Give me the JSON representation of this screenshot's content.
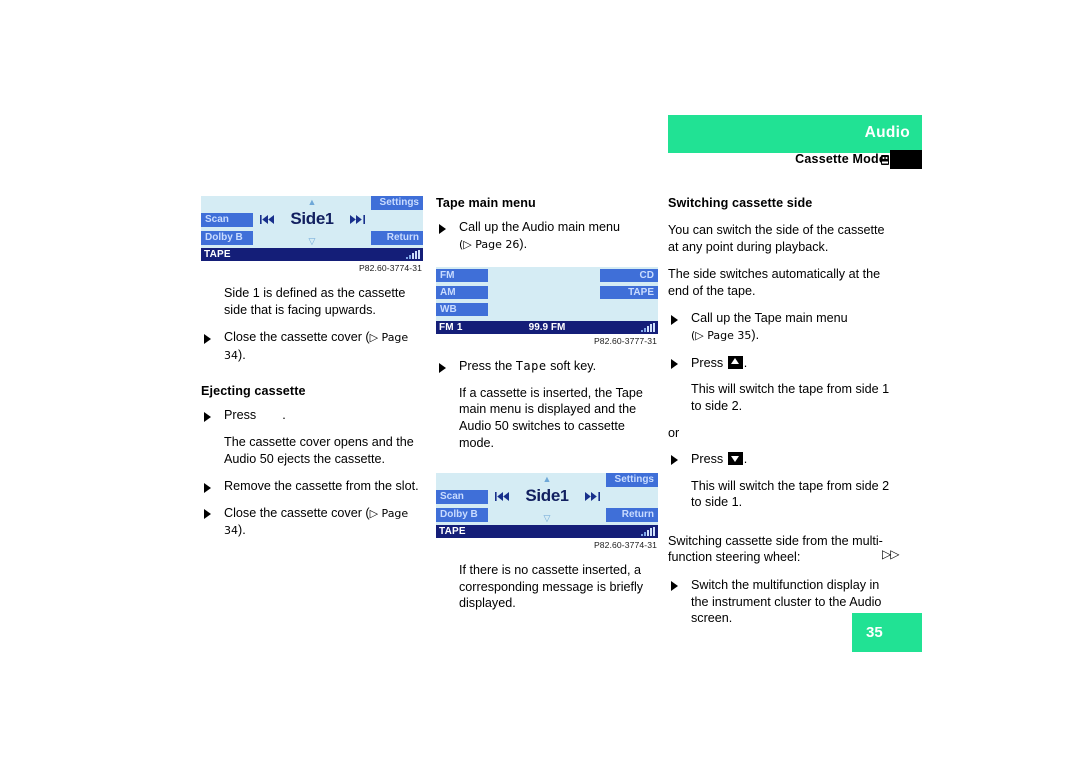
{
  "header": {
    "brand": "Audio",
    "section": "Cassette Mode",
    "brand_color": "#21e294"
  },
  "page_number": "35",
  "continuation_marker": "▷▷",
  "col1": {
    "display": {
      "softkey_top_right": "Settings",
      "softkey_left_top": "Scan",
      "softkey_left_bottom": "Dolby B",
      "softkey_bottom_right": "Return",
      "title": "Side",
      "title_number": "1",
      "prev_icon": "skip-back-icon",
      "next_icon": "skip-forward-icon",
      "arrow_up": "▲",
      "arrow_down": "▽",
      "status_left": "TAPE"
    },
    "caption": "P82.60-3774-31",
    "para1": "Side 1 is defined as the cassette side that is facing upwards.",
    "bullet1_pre": "Close the cassette cover (",
    "bullet1_ref": "▷ Page 34",
    "bullet1_post": ").",
    "heading_eject": "Ejecting cassette",
    "bullet2_pre": "Press",
    "bullet2_post": ".",
    "para2": "The cassette cover opens and the Audio 50 ejects the cassette.",
    "bullet3": "Remove the cassette from the slot.",
    "bullet4_pre": "Close the cassette cover (",
    "bullet4_ref": "▷ Page 34",
    "bullet4_post": ")."
  },
  "col2": {
    "heading": "Tape main menu",
    "bullet1_pre": "Call up the Audio main menu",
    "bullet1_ref": "(▷ Page 26",
    "bullet1_post": ").",
    "radio_display": {
      "btn_fm": "FM",
      "btn_am": "AM",
      "btn_wb": "WB",
      "btn_cd": "CD",
      "btn_tape": "TAPE",
      "status_left": "FM 1",
      "status_mid": "99.9 FM"
    },
    "radio_caption": "P82.60-3777-31",
    "bullet2_pre": "Press the",
    "bullet2_key": "Tape",
    "bullet2_post": "soft key.",
    "para1": "If a cassette is inserted, the Tape main menu is displayed and the Audio 50 switches to cassette mode.",
    "display": {
      "softkey_top_right": "Settings",
      "softkey_left_top": "Scan",
      "softkey_left_bottom": "Dolby B",
      "softkey_bottom_right": "Return",
      "title": "Side",
      "title_number": "1",
      "arrow_up": "▲",
      "arrow_down": "▽",
      "status_left": "TAPE"
    },
    "caption": "P82.60-3774-31",
    "para2": "If there is no cassette inserted, a corresponding message is briefly displayed."
  },
  "col3": {
    "heading": "Switching cassette side",
    "para1": "You can switch the side of the cassette at any point during playback.",
    "para2": "The side switches automatically at the end of the tape.",
    "bullet1_pre": "Call up the Tape main menu",
    "bullet1_ref": "(▷ Page 35",
    "bullet1_post": ").",
    "bullet2_pre": "Press",
    "bullet2_key": "up-arrow-key",
    "bullet2_post": ".",
    "para3": "This will switch the tape from side 1 to side 2.",
    "or": "or",
    "bullet3_pre": "Press",
    "bullet3_key": "down-arrow-key",
    "bullet3_post": ".",
    "para4": "This will switch the tape from side 2 to side 1.",
    "para5": "Switching cassette side from the multi-function steering wheel:",
    "bullet4": "Switch the multifunction display in the instrument cluster to the Audio screen."
  }
}
